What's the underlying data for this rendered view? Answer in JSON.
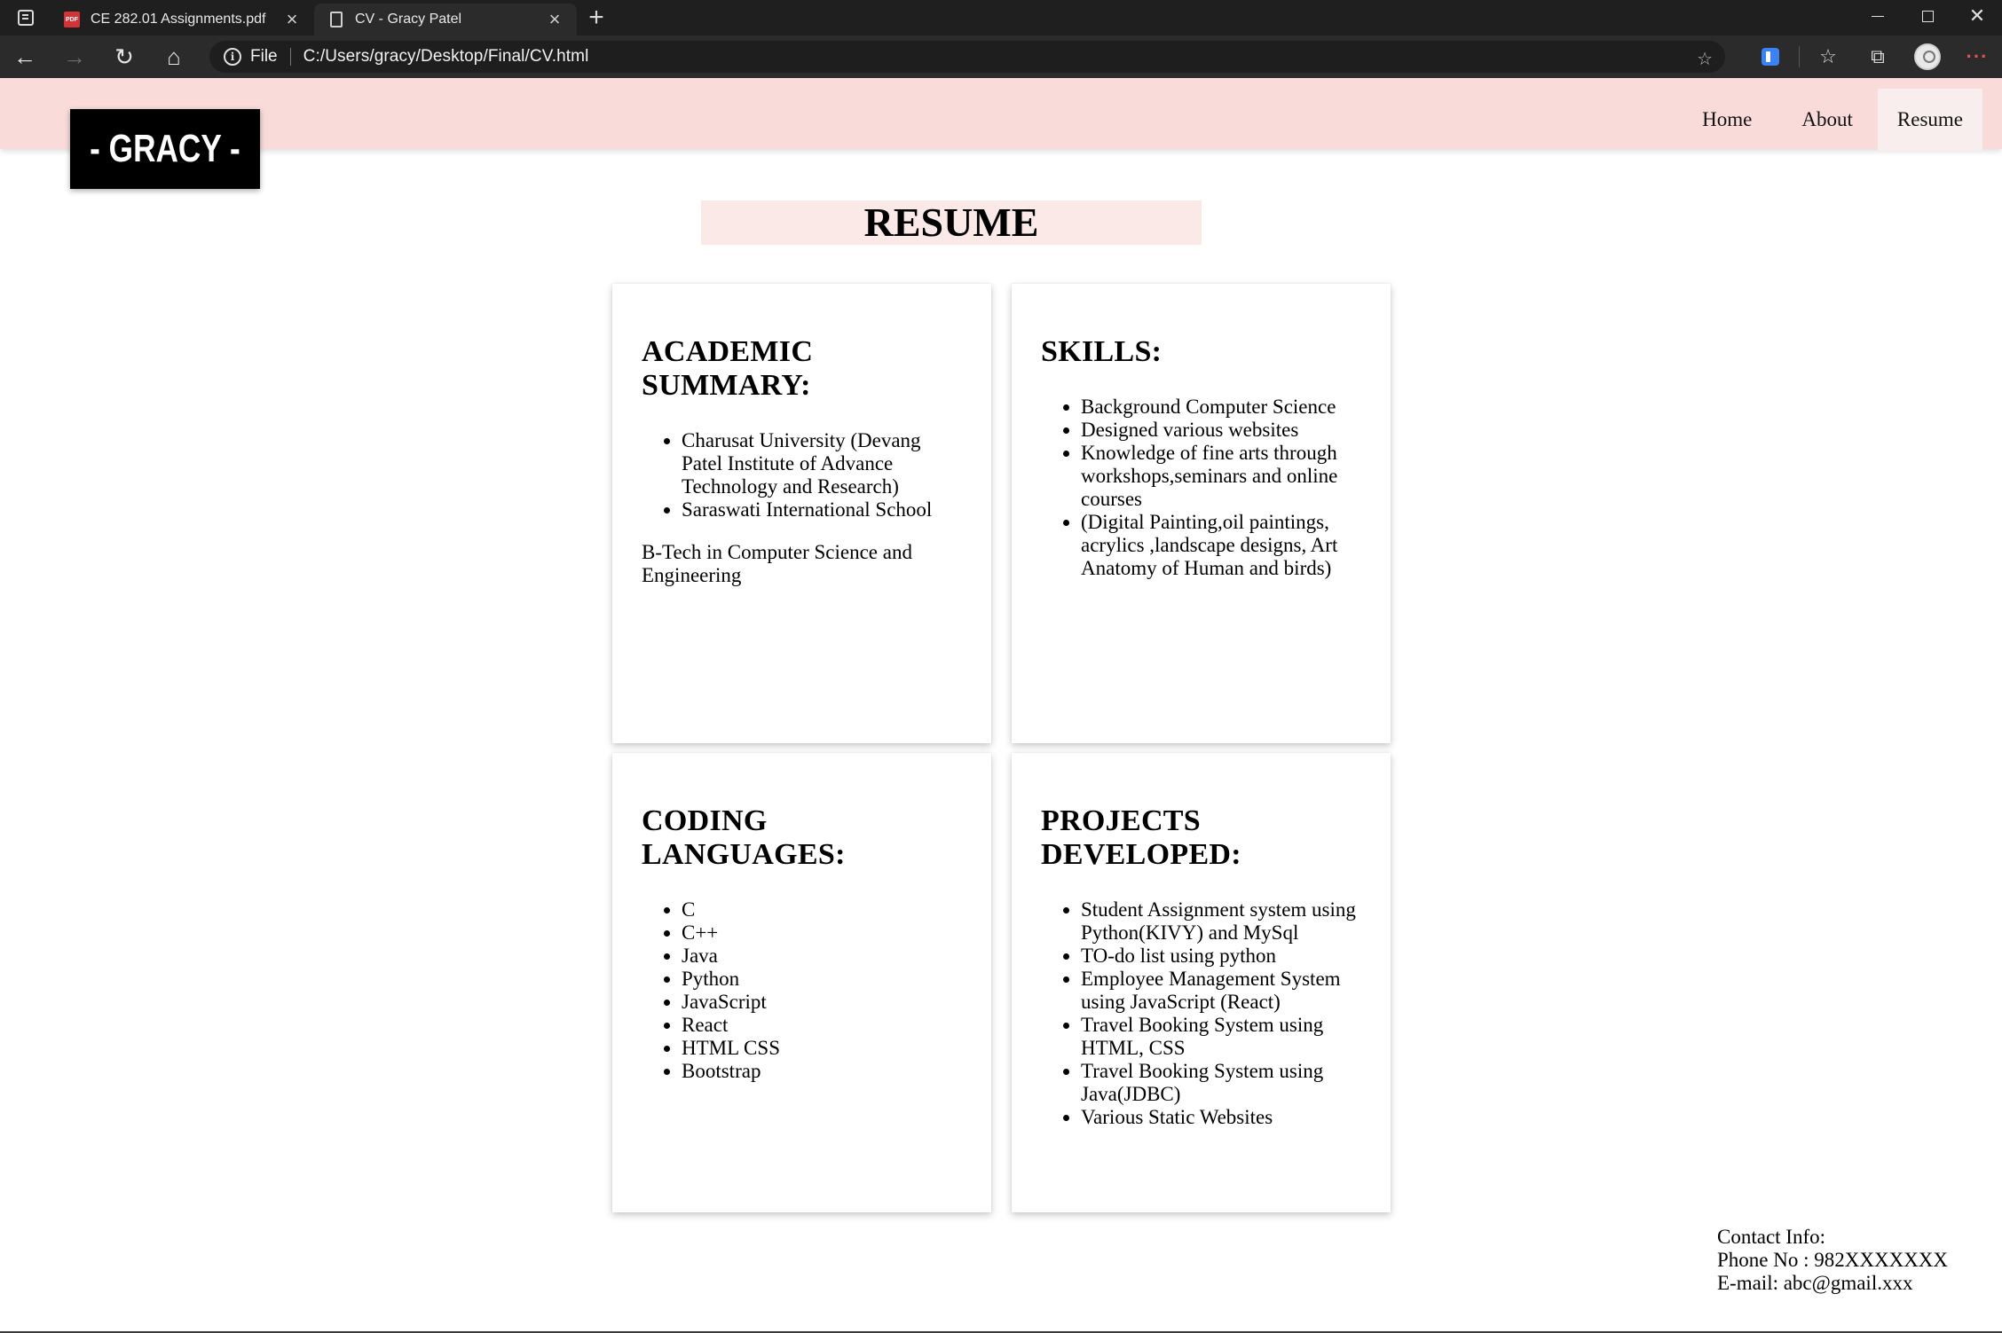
{
  "browser": {
    "tabs": [
      {
        "title": "CE 282.01 Assignments.pdf",
        "icon": "pdf-icon",
        "active": false
      },
      {
        "title": "CV - Gracy Patel",
        "icon": "page-icon",
        "active": true
      }
    ],
    "new_tab": "+",
    "address": {
      "scheme": "File",
      "url": "C:/Users/gracy/Desktop/Final/CV.html"
    }
  },
  "site": {
    "logo": "- GRACY -",
    "nav": [
      {
        "label": "Home"
      },
      {
        "label": "About"
      },
      {
        "label": "Resume",
        "active": true
      }
    ],
    "page_title": "RESUME",
    "header_color": "#f9dcda"
  },
  "cards": {
    "academic": {
      "heading_line1": "ACADEMIC",
      "heading_line2": "SUMMARY:",
      "items": [
        "Charusat University (Devang Patel Institute of Advance Technology and Research)",
        "Saraswati International School"
      ],
      "note": "B-Tech in Computer Science and Engineering"
    },
    "skills": {
      "heading_line1": "SKILLS:",
      "items": [
        "Background Computer Science",
        "Designed various websites",
        "Knowledge of fine arts through workshops,seminars and online courses",
        "(Digital Painting,oil paintings, acrylics ,landscape designs, Art Anatomy of Human and birds)"
      ]
    },
    "coding": {
      "heading_line1": "CODING",
      "heading_line2": "LANGUAGES:",
      "items": [
        "C",
        "C++",
        "Java",
        "Python",
        "JavaScript",
        "React",
        "HTML CSS",
        "Bootstrap"
      ]
    },
    "projects": {
      "heading_line1": "PROJECTS",
      "heading_line2": "DEVELOPED:",
      "items": [
        "Student Assignment system using Python(KIVY) and MySql",
        "TO-do list using python",
        "Employee Management System using JavaScript (React)",
        "Travel Booking System using HTML, CSS",
        "Travel Booking System using Java(JDBC)",
        "Various Static Websites"
      ]
    }
  },
  "contact": {
    "label": "Contact Info:",
    "phone": "Phone No : 982XXXXXXX",
    "email": "E-mail: abc@gmail.xxx"
  }
}
